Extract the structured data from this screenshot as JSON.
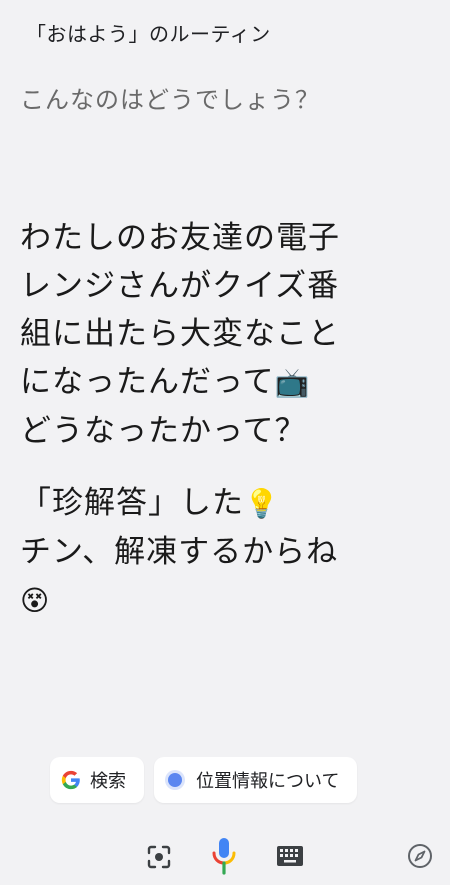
{
  "header": {
    "routine_title": "「おはよう」のルーティン",
    "suggestion_prompt": "こんなのはどうでしょう？"
  },
  "response": {
    "paragraph_1_text": "わたしのお友達の電子レンジさんがクイズ番組に出たら大変なことになったんだって",
    "paragraph_1_emoji": "📺",
    "paragraph_1_line2": "どうなったかって？",
    "paragraph_2_text": "「珍解答」した",
    "paragraph_2_emoji_1": "💡",
    "paragraph_2_text_2": "チン、解凍するからね",
    "paragraph_2_emoji_2": "😵"
  },
  "chips": [
    {
      "label": "検索",
      "icon": "google-g-icon"
    },
    {
      "label": "位置情報について",
      "icon": "location-dot-icon"
    }
  ],
  "bottom_bar": {
    "icons": [
      "lens-icon",
      "microphone-icon",
      "keyboard-icon",
      "compass-icon"
    ],
    "colors": {
      "google_blue": "#4285F4",
      "google_red": "#EA4335",
      "google_yellow": "#FBBC05",
      "google_green": "#34A853",
      "icon_gray": "#3c4043"
    }
  }
}
